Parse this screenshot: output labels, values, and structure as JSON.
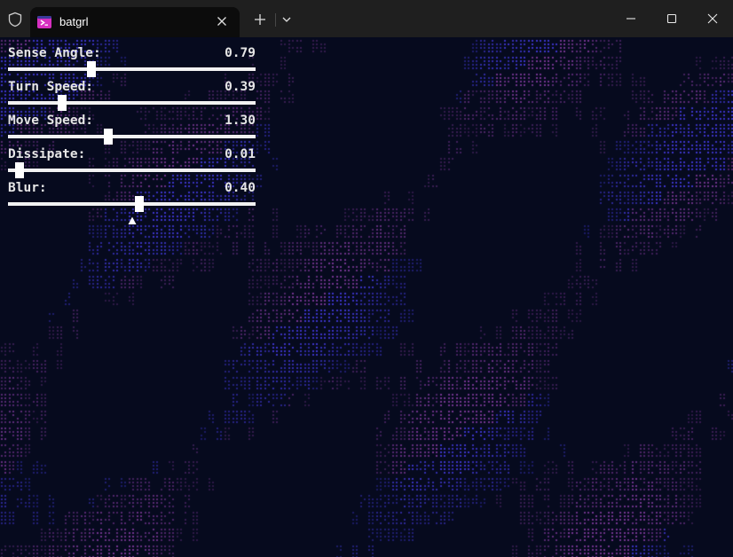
{
  "window": {
    "tab_title": "batgrl",
    "colors": {
      "titlebar": "#1f1f1f",
      "tab": "#0c0c0c",
      "terminal_bg": "#060a1e",
      "accent_magenta": "#d62fc0"
    }
  },
  "controls": [
    {
      "label": "Sense Angle:",
      "value": "0.79",
      "fraction": 0.33
    },
    {
      "label": "Turn Speed:",
      "value": "0.39",
      "fraction": 0.21
    },
    {
      "label": "Move Speed:",
      "value": "1.30",
      "fraction": 0.4
    },
    {
      "label": "Dissipate:",
      "value": "0.01",
      "fraction": 0.03
    },
    {
      "label": "Blur:",
      "value": "0.40",
      "fraction": 0.53
    }
  ],
  "icons": [
    "shield-icon",
    "terminal-app-icon",
    "close-icon",
    "plus-icon",
    "chevron-down-icon",
    "minimize-icon",
    "maximize-icon",
    "window-close-icon",
    "pointer-icon"
  ]
}
